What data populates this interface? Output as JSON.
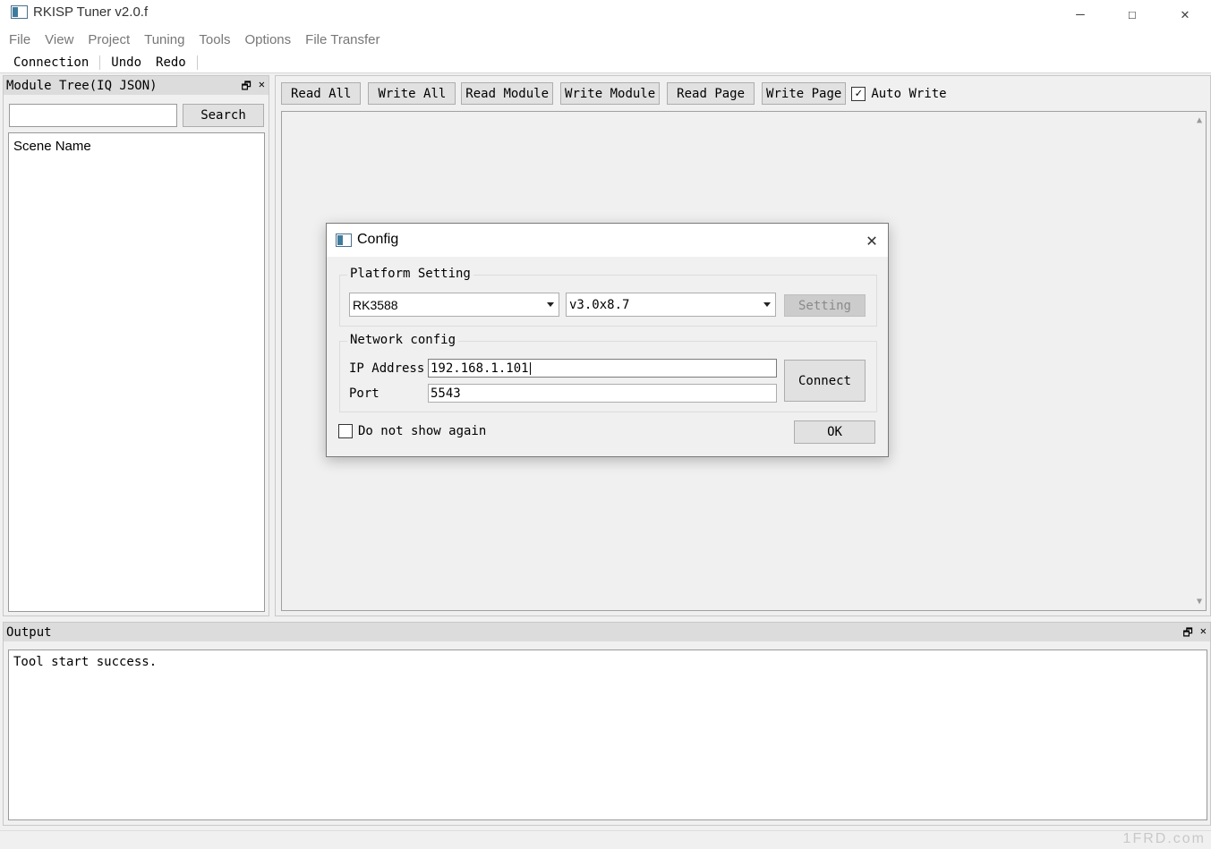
{
  "window": {
    "title": "RKISP Tuner v2.0.f",
    "minimize_glyph": "—",
    "maximize_glyph": "☐",
    "close_glyph": "✕"
  },
  "menubar": {
    "items": [
      "File",
      "View",
      "Project",
      "Tuning",
      "Tools",
      "Options",
      "File Transfer"
    ]
  },
  "toolbar": {
    "connection": "Connection",
    "undo": "Undo",
    "redo": "Redo"
  },
  "module_tree": {
    "title": "Module Tree(IQ JSON)",
    "search_value": "",
    "search_button": "Search",
    "items": [
      "Scene Name"
    ]
  },
  "main_toolbar": {
    "buttons": [
      "Read All",
      "Write All",
      "Read Module",
      "Write Module",
      "Read Page",
      "Write Page"
    ],
    "auto_write_label": "Auto Write",
    "auto_write_checked": true
  },
  "output": {
    "title": "Output",
    "text": "Tool start success."
  },
  "dialog": {
    "title": "Config",
    "platform_group": "Platform Setting",
    "platform_value": "RK3588",
    "version_value": "v3.0x8.7",
    "setting_button": "Setting",
    "network_group": "Network config",
    "ip_label": "IP Address",
    "ip_value": "192.168.1.101",
    "port_label": "Port",
    "port_value": "5543",
    "connect_button": "Connect",
    "dont_show_label": "Do not show again",
    "dont_show_checked": false,
    "ok_button": "OK"
  },
  "watermark": "1FRD.com",
  "icons": {
    "app": "app-icon",
    "float": "float-icon",
    "close": "close-icon",
    "check": "✓"
  }
}
